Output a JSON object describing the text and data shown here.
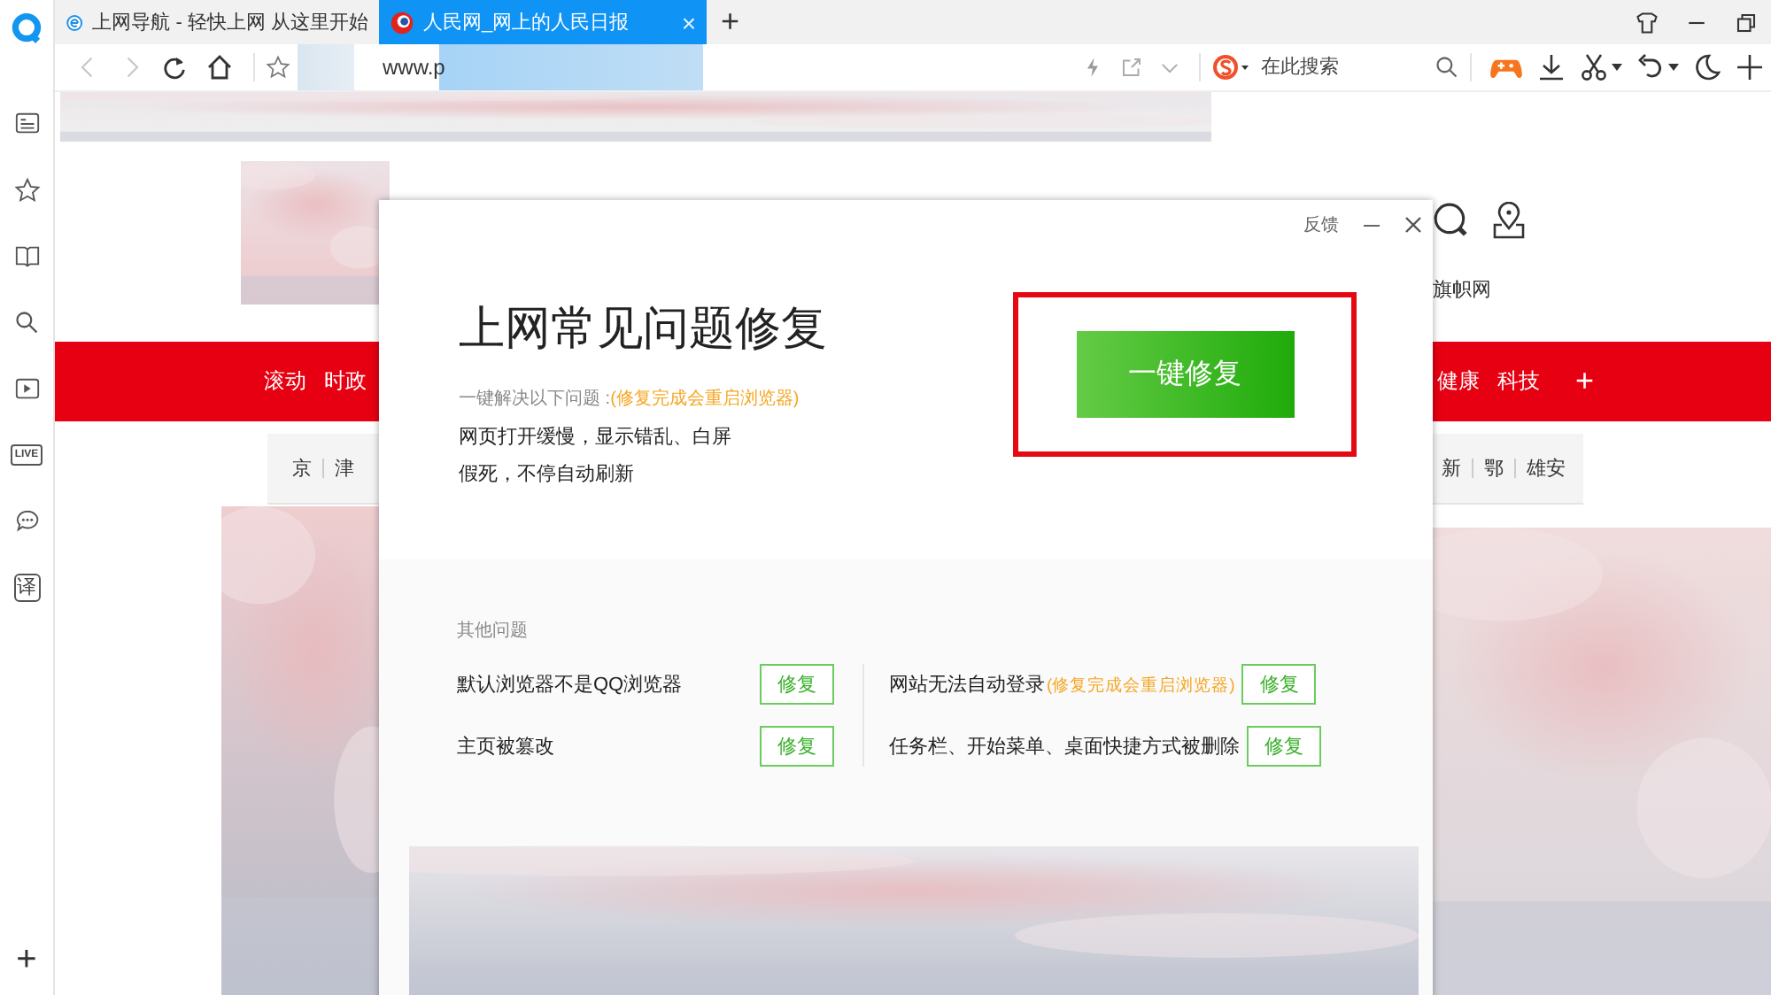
{
  "sidebar": [
    {
      "kind": "logo"
    },
    {
      "kind": "list"
    },
    {
      "kind": "star"
    },
    {
      "kind": "book"
    },
    {
      "kind": "search"
    },
    {
      "kind": "play"
    },
    {
      "kind": "live",
      "label": "LIVE"
    },
    {
      "kind": "chat"
    },
    {
      "kind": "translate",
      "label": "译"
    }
  ],
  "sidebar_add": "+",
  "tabs": [
    {
      "kind": "nav",
      "title": "上网导航 - 轻快上网 从这里开始",
      "selected": false
    },
    {
      "kind": "news",
      "title": "人民网_网上的人民日报",
      "selected": true
    }
  ],
  "tab_close": "×",
  "new_tab": "+",
  "window_controls": [
    {
      "kind": "shirt"
    },
    {
      "kind": "minimize"
    },
    {
      "kind": "restore"
    }
  ],
  "toolbar_left": [
    {
      "kind": "back",
      "disabled": true
    },
    {
      "kind": "forward",
      "disabled": true
    },
    {
      "kind": "reload",
      "disabled": false
    },
    {
      "kind": "home",
      "disabled": false
    }
  ],
  "address": {
    "value": "www.p"
  },
  "address_tools": [
    {
      "kind": "bolt"
    },
    {
      "kind": "share"
    },
    {
      "kind": "chevron"
    }
  ],
  "search": {
    "placeholder": "在此搜索"
  },
  "toolbar_right": [
    {
      "kind": "game",
      "dropdown": false
    },
    {
      "kind": "download",
      "dropdown": false
    },
    {
      "kind": "cut",
      "dropdown": true
    },
    {
      "kind": "undo",
      "dropdown": true
    },
    {
      "kind": "moon",
      "dropdown": false
    },
    {
      "kind": "plus",
      "dropdown": false
    }
  ],
  "page": {
    "header_link": "旗帜网",
    "nav_left": [
      "滚动",
      "时政"
    ],
    "nav_right": [
      "健康",
      "科技"
    ],
    "nav_add": "+",
    "regions_left": [
      "京",
      "津"
    ],
    "regions_right": [
      "新",
      "鄂",
      "雄安"
    ]
  },
  "dialog": {
    "feedback": "反馈",
    "heading": "上网常见问题修复",
    "subtitle": "一键解决以下问题 :",
    "subtitle_note": "(修复完成会重启浏览器)",
    "issues": [
      "网页打开缓慢，显示错乱、白屏",
      "假死，不停自动刷新"
    ],
    "primary_button": "一键修复",
    "highlighted": true,
    "other_title": "其他问题",
    "other_columns": [
      [
        {
          "text": "默认浏览器不是QQ浏览器",
          "button": "修复"
        },
        {
          "text": "主页被篡改",
          "button": "修复"
        }
      ],
      [
        {
          "text": "网站无法自动登录",
          "note": "(修复完成会重启浏览器)",
          "button": "修复"
        },
        {
          "text": "任务栏、开始菜单、桌面快捷方式被删除",
          "button": "修复"
        }
      ]
    ]
  }
}
